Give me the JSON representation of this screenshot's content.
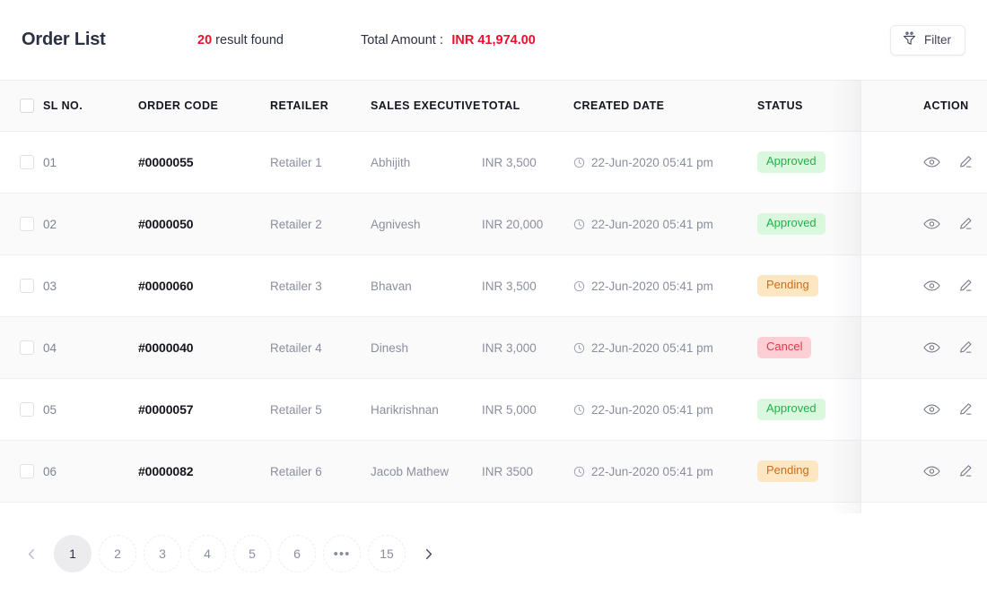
{
  "header": {
    "page_title": "Order List",
    "result_count": "20",
    "result_label": "result found",
    "total_amount_label": "Total Amount :",
    "total_amount_value": "INR 41,974.00",
    "filter_label": "Filter",
    "filter_icon": "funnel-icon",
    "accent_color": "#e8112d"
  },
  "table": {
    "columns": [
      {
        "key": "select",
        "label": ""
      },
      {
        "key": "sl_no",
        "label": "SL NO."
      },
      {
        "key": "order_code",
        "label": "ORDER CODE"
      },
      {
        "key": "retailer",
        "label": "RETAILER"
      },
      {
        "key": "sales_executive",
        "label": "SALES EXECUTIVE"
      },
      {
        "key": "total",
        "label": "TOTAL"
      },
      {
        "key": "created_date",
        "label": "CREATED DATE"
      },
      {
        "key": "status",
        "label": "STATUS"
      },
      {
        "key": "action",
        "label": "ACTION"
      }
    ],
    "rows": [
      {
        "sl_no": "01",
        "order_code": "#0000055",
        "retailer": "Retailer 1",
        "sales_executive": "Abhijith",
        "total": "INR 3,500",
        "created_date": "22-Jun-2020 05:41 pm",
        "status": "Approved",
        "status_type": "approved"
      },
      {
        "sl_no": "02",
        "order_code": "#0000050",
        "retailer": "Retailer 2",
        "sales_executive": "Agnivesh",
        "total": "INR 20,000",
        "created_date": "22-Jun-2020 05:41 pm",
        "status": "Approved",
        "status_type": "approved"
      },
      {
        "sl_no": "03",
        "order_code": "#0000060",
        "retailer": "Retailer 3",
        "sales_executive": "Bhavan",
        "total": "INR 3,500",
        "created_date": "22-Jun-2020 05:41 pm",
        "status": "Pending",
        "status_type": "pending"
      },
      {
        "sl_no": "04",
        "order_code": "#0000040",
        "retailer": "Retailer 4",
        "sales_executive": "Dinesh",
        "total": "INR 3,000",
        "created_date": "22-Jun-2020 05:41 pm",
        "status": "Cancel",
        "status_type": "cancel"
      },
      {
        "sl_no": "05",
        "order_code": "#0000057",
        "retailer": "Retailer 5",
        "sales_executive": "Harikrishnan",
        "total": "INR 5,000",
        "created_date": "22-Jun-2020 05:41 pm",
        "status": "Approved",
        "status_type": "approved"
      },
      {
        "sl_no": "06",
        "order_code": "#0000082",
        "retailer": "Retailer 6",
        "sales_executive": "Jacob Mathew",
        "total": "INR 3500",
        "created_date": "22-Jun-2020 05:41 pm",
        "status": "Pending",
        "status_type": "pending"
      }
    ],
    "row_action_icons": [
      "eye-icon",
      "pencil-icon",
      "trash-icon"
    ],
    "date_icon": "clock-icon",
    "status_colors": {
      "approved_bg": "#d9f8de",
      "approved_text": "#27ae4a",
      "pending_bg": "#fde7c3",
      "pending_text": "#cb6d1c",
      "cancel_bg": "#fbcfd4",
      "cancel_text": "#d63b4b"
    }
  },
  "pagination": {
    "prev_icon": "chevron-left-icon",
    "next_icon": "chevron-right-icon",
    "items": [
      "1",
      "2",
      "3",
      "4",
      "5",
      "6",
      "•••",
      "15"
    ],
    "active_index": 0,
    "ellipsis_index": 6
  }
}
